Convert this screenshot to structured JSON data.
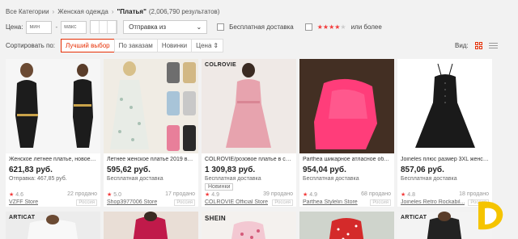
{
  "breadcrumb": {
    "items": [
      "Все Категории",
      "Женская одежда"
    ],
    "current": "\"Платья\"",
    "count": "(2,006,790 результатов)"
  },
  "filters": {
    "price_label": "Цена:",
    "min_placeholder": "мин",
    "max_placeholder": "макс",
    "dash": "-",
    "ship_from": "Отправка из",
    "free_shipping": "Бесплатная доставка",
    "rating_suffix": "или более",
    "rating_stars": "★★★★",
    "rating_empty": "★"
  },
  "sort": {
    "label": "Сортировать по:",
    "options": [
      "Лучший выбор",
      "По заказам",
      "Новинки",
      "Цена"
    ],
    "view_label": "Вид:"
  },
  "products": [
    {
      "title": "Женское летнее платье, новое О...",
      "price": "621,83 руб.",
      "ship": "Отправка: 467,85 руб.",
      "rating": "4.6",
      "orders": "22 продано",
      "store": "VZFF Store",
      "mark": "Россия"
    },
    {
      "title": "Летнее женское платье 2019 вин...",
      "price": "595,62 руб.",
      "ship": "Бесплатная доставка",
      "rating": "5.0",
      "orders": "17 продано",
      "store": "Shop3977006 Store",
      "mark": "Россия"
    },
    {
      "title": "COLROVIE/розовое платье в стил...",
      "price": "1 309,83 руб.",
      "ship": "Бесплатная доставка",
      "badge": "Новинки",
      "rating": "4.9",
      "orders": "39 продано",
      "store": "COLROVIE Official Store",
      "mark": "Россия"
    },
    {
      "title": "Parthea шикарное атласное обле...",
      "price": "954,04 руб.",
      "ship": "Бесплатная доставка",
      "rating": "4.9",
      "orders": "68 продано",
      "store": "Parthea Stylelin Store",
      "mark": "Россия"
    },
    {
      "title": "Joineles плюс размер 3XL женско...",
      "price": "857,06 руб.",
      "ship": "Бесплатная доставка",
      "rating": "4.8",
      "orders": "18 продано",
      "store": "Joineles Retro Rockabil...",
      "mark": "Россия"
    }
  ],
  "image_brands": [
    "COLROVIE"
  ],
  "row2_brands": [
    "ARTICAT",
    "",
    "SHEIN",
    "",
    "ARTICAT"
  ],
  "colors": {
    "accent": "#e62e04",
    "star": "#f33b3b"
  },
  "icons": [
    "chevron-right-icon",
    "chevron-down-icon",
    "sort-arrow-icon",
    "grid-view-icon",
    "list-view-icon"
  ]
}
